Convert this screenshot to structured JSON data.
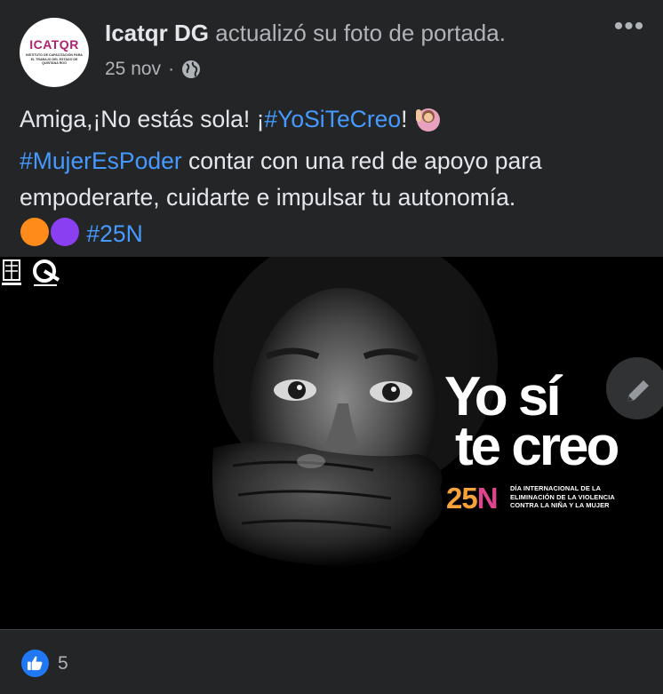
{
  "post": {
    "author": "Icatqr DG",
    "action": " actualizó su foto de portada.",
    "date": "25 nov",
    "date_separator": "·",
    "privacy_icon": "globe-icon",
    "more_label": "•••",
    "avatar": {
      "name": "ICATQR",
      "subtitle": "INSTITUTO DE CAPACITACIÓN PARA EL TRABAJO DEL ESTADO DE QUINTANA ROO",
      "name_color": "#b0226f"
    }
  },
  "text": {
    "p1": "Amiga,¡No estás sola! ¡",
    "tag1": "#YoSiTeCreo",
    "p2": "! ",
    "emoji1": "raising-hand-emoji",
    "tag2": "#MujerEsPoder",
    "p3": " contar con una red de apoyo para empoderarte, cuidarte e impulsar tu autonomía.",
    "circle_orange": "#ff8c1a",
    "circle_purple": "#8a3ff0",
    "tag3": "#25N",
    "hashtag_color": "#4599ff"
  },
  "image": {
    "title_line1": "Yo sí",
    "title_line2": "te creo",
    "badge_two": "25",
    "badge_n": "N",
    "caption": "DÍA INTERNACIONAL DE LA ELIMINACIÓN DE LA VIOLENCIA CONTRA LA NIÑA Y LA MUJER",
    "badge_color_orange": "#f7a23a",
    "badge_color_pink": "#e0448f",
    "edit_icon": "pencil-icon"
  },
  "footer": {
    "like_icon": "thumbs-up-icon",
    "reaction_count": "5"
  }
}
